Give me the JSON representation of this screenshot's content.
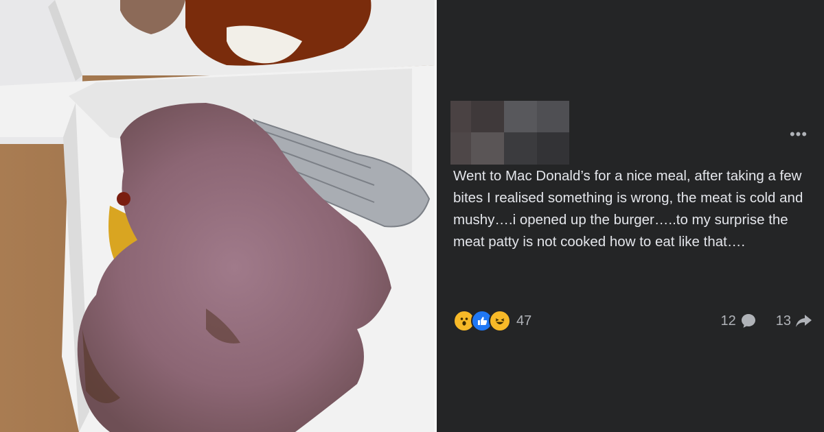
{
  "post": {
    "text": "Went to Mac Donald’s for a nice meal, after taking a few bites I realised something is wrong, the meat is cold and mushy….i opened up the burger…..to my surprise the meat patty is not cooked how to eat like that….",
    "more_icon": "three-dots-icon",
    "reactions": {
      "icons": [
        "wow-icon",
        "like-icon",
        "haha-icon"
      ],
      "count": "47"
    },
    "comments_count": "12",
    "comments_icon": "comment-bubble-icon",
    "shares_count": "13",
    "shares_icon": "share-arrow-icon"
  },
  "colors": {
    "panel_bg": "#242526",
    "text": "#e4e6eb",
    "muted": "#b0b3b8",
    "like_blue": "#2078f4",
    "emoji_yellow": "#f7b928"
  }
}
